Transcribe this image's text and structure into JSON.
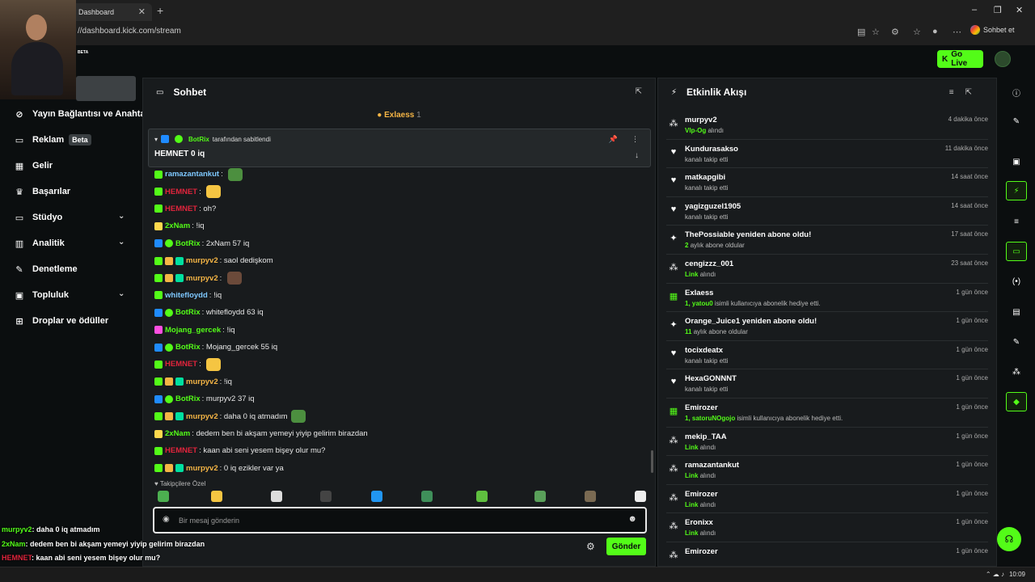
{
  "browser": {
    "tab_title": "Dashboard",
    "url": "//dashboard.kick.com/stream",
    "profile_button": "Sohbet et"
  },
  "topbar": {
    "logo_beta": "BETA",
    "go_live": "Go Live"
  },
  "sidebar": {
    "items": [
      {
        "label": "Yayın Bağlantısı ve Anahta",
        "icon": "link-icon"
      },
      {
        "label": "Reklam",
        "badge": "Beta",
        "icon": "ad-icon"
      },
      {
        "label": "Gelir",
        "icon": "revenue-icon"
      },
      {
        "label": "Başarılar",
        "icon": "trophy-icon"
      },
      {
        "label": "Stüdyo",
        "icon": "studio-icon"
      },
      {
        "label": "Analitik",
        "icon": "analytics-icon"
      },
      {
        "label": "Denetleme",
        "icon": "wrench-icon"
      },
      {
        "label": "Topluluk",
        "icon": "community-icon"
      },
      {
        "label": "Droplar ve ödüller",
        "icon": "gift-icon"
      }
    ]
  },
  "chat": {
    "title": "Sohbet",
    "top_gifter": {
      "name": "Exlaess",
      "count": "1"
    },
    "pinned": {
      "by_user": "BotRix",
      "by_text": "tarafından sabitlendi",
      "message": "HEMNET 0 iq"
    },
    "messages": [
      {
        "user": "ramazantankut",
        "text": "",
        "color": "#7ec8ff"
      },
      {
        "user": "HEMNET",
        "text": "",
        "color": "#e0243c"
      },
      {
        "user": "HEMNET",
        "text": "oh?",
        "color": "#e0243c"
      },
      {
        "user": "2xNam",
        "text": "!iq",
        "color": "#53fc18"
      },
      {
        "user": "BotRix",
        "text": "2xNam 57 iq",
        "color": "#53fc18"
      },
      {
        "user": "murpyv2",
        "text": "saol dedişkom",
        "color": "#f5b545"
      },
      {
        "user": "murpyv2",
        "text": "",
        "color": "#f5b545"
      },
      {
        "user": "whitefloydd",
        "text": "!iq",
        "color": "#7ec8ff"
      },
      {
        "user": "BotRix",
        "text": "whitefloydd 63 iq",
        "color": "#53fc18"
      },
      {
        "user": "Mojang_gercek",
        "text": "!iq",
        "color": "#53fc18"
      },
      {
        "user": "BotRix",
        "text": "Mojang_gercek 55 iq",
        "color": "#53fc18"
      },
      {
        "user": "HEMNET",
        "text": "",
        "color": "#e0243c"
      },
      {
        "user": "murpyv2",
        "text": "!iq",
        "color": "#f5b545"
      },
      {
        "user": "BotRix",
        "text": "murpyv2 37 iq",
        "color": "#53fc18"
      },
      {
        "user": "murpyv2",
        "text": "daha 0 iq atmadım",
        "color": "#f5b545"
      },
      {
        "user": "2xNam",
        "text": "dedem ben bi akşam yemeyi yiyip gelirim birazdan",
        "color": "#53fc18"
      },
      {
        "user": "HEMNET",
        "text": "kaan abi seni yesem bişey olur mu?",
        "color": "#e0243c"
      },
      {
        "user": "murpyv2",
        "text": "0 iq ezikler var ya",
        "color": "#f5b545"
      }
    ],
    "followers_only_label": "Takipçilere Özel",
    "input_placeholder": "Bir mesaj gönderin",
    "send_label": "Gönder"
  },
  "activity": {
    "title": "Etkinlik Akışı",
    "items": [
      {
        "title": "murpyv2",
        "sub_hl": "VIp-Og",
        "sub": "alındı",
        "time": "4 dakika önce",
        "icon": "badge-icon"
      },
      {
        "title": "Kundurasakso",
        "sub_hl": "",
        "sub": "kanalı takip etti",
        "time": "11 dakika önce",
        "icon": "heart-icon"
      },
      {
        "title": "matkapgibi",
        "sub_hl": "",
        "sub": "kanalı takip etti",
        "time": "14 saat önce",
        "icon": "heart-icon"
      },
      {
        "title": "yagizguzel1905",
        "sub_hl": "",
        "sub": "kanalı takip etti",
        "time": "14 saat önce",
        "icon": "heart-icon"
      },
      {
        "title": "ThePossiable yeniden abone oldu!",
        "sub_hl": "2",
        "sub": "aylık abone oldular",
        "time": "17 saat önce",
        "icon": "sparkle-icon"
      },
      {
        "title": "cengizzz_001",
        "sub_hl": "Link",
        "sub": "alındı",
        "time": "23 saat önce",
        "icon": "badge-icon"
      },
      {
        "title": "Exlaess",
        "sub_hl": "1, yatou0",
        "sub": "isimli kullanıcıya abonelik hediye etti.",
        "time": "1 gün önce",
        "icon": "gift-icon"
      },
      {
        "title": "Orange_Juice1 yeniden abone oldu!",
        "sub_hl": "11",
        "sub": "aylık abone oldular",
        "time": "1 gün önce",
        "icon": "sparkle-icon"
      },
      {
        "title": "tocixdeatx",
        "sub_hl": "",
        "sub": "kanalı takip etti",
        "time": "1 gün önce",
        "icon": "heart-icon"
      },
      {
        "title": "HexaGONNNT",
        "sub_hl": "",
        "sub": "kanalı takip etti",
        "time": "1 gün önce",
        "icon": "heart-icon"
      },
      {
        "title": "Emirozer",
        "sub_hl": "1, satoruNOgojo",
        "sub": "isimli kullanıcıya abonelik hediye etti.",
        "time": "1 gün önce",
        "icon": "gift-icon"
      },
      {
        "title": "mekip_TAA",
        "sub_hl": "Link",
        "sub": "alındı",
        "time": "1 gün önce",
        "icon": "badge-icon"
      },
      {
        "title": "ramazantankut",
        "sub_hl": "Link",
        "sub": "alındı",
        "time": "1 gün önce",
        "icon": "badge-icon"
      },
      {
        "title": "Emirozer",
        "sub_hl": "Link",
        "sub": "alındı",
        "time": "1 gün önce",
        "icon": "badge-icon"
      },
      {
        "title": "Eronixx",
        "sub_hl": "Link",
        "sub": "alındı",
        "time": "1 gün önce",
        "icon": "badge-icon"
      },
      {
        "title": "Emirozer",
        "sub_hl": "",
        "sub": "",
        "time": "1 gün önce",
        "icon": "badge-icon"
      }
    ]
  },
  "overlay": [
    {
      "user": "murpyv2",
      "text": ": daha 0 iq atmadım",
      "color": "#53fc18"
    },
    {
      "user": "2xNam",
      "text": ": dedem ben bi akşam yemeyi yiyip gelirim birazdan",
      "color": "#53fc18"
    },
    {
      "user": "HEMNET",
      "text": ": kaan abi seni yesem bişey olur mu?",
      "color": "#e0243c"
    },
    {
      "user": "murpyv2",
      "text": ": 0 iq ezikler var ya",
      "color": "#53fc18"
    }
  ],
  "taskbar": {
    "clock": "10:09"
  },
  "colors": {
    "accent": "#53fc18",
    "panel": "#181b1d",
    "background": "#0b0e0f"
  }
}
